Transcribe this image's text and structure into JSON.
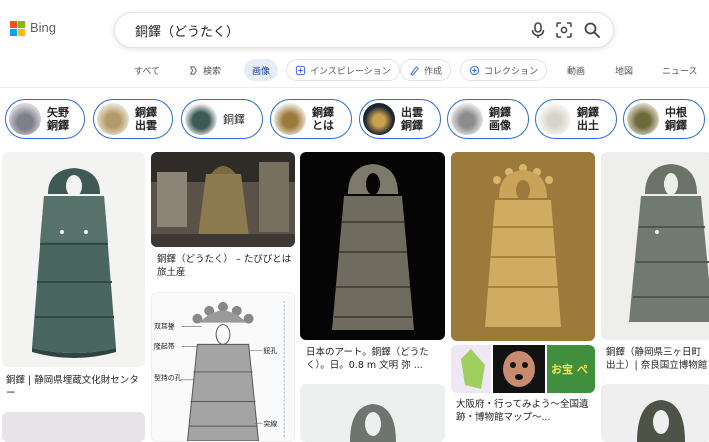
{
  "brand": {
    "name": "Bing",
    "logo_colors": [
      "#f25022",
      "#7fba00",
      "#00a4ef",
      "#ffb900"
    ]
  },
  "search": {
    "query": "銅鐸（どうたく）",
    "icons": [
      "microphone-icon",
      "visual-search-icon",
      "search-icon"
    ]
  },
  "tabs": [
    {
      "label": "すべて",
      "icon": null
    },
    {
      "label": "検索",
      "icon": "copilot-icon"
    },
    {
      "label": "画像",
      "icon": null,
      "active": true
    },
    {
      "label": "インスピレーション",
      "icon": "sparkle-icon"
    },
    {
      "label": "作成",
      "icon": "create-icon"
    },
    {
      "label": "コレクション",
      "icon": "collection-icon"
    },
    {
      "label": "動画",
      "icon": null
    },
    {
      "label": "地図",
      "icon": null
    },
    {
      "label": "ニュース",
      "icon": null
    }
  ],
  "related": [
    {
      "label": "矢野\n銅鐸"
    },
    {
      "label": "銅鐸\n出雲"
    },
    {
      "label": "銅鐸"
    },
    {
      "label": "銅鐸\nとは"
    },
    {
      "label": "出雲\n銅鐸"
    },
    {
      "label": "銅鐸\n画像"
    },
    {
      "label": "銅鐸\n出土"
    },
    {
      "label": "中根\n銅鐸"
    }
  ],
  "results": [
    {
      "caption": "銅鐸 | 静岡県埋蔵文化財センター"
    },
    {
      "caption": "銅鐸（どうたく） – たびびとは旅土産"
    },
    {
      "caption": "日本のアート。銅鐸（どうたく）。日。0.8 m 文明 弥 ..."
    },
    {
      "caption": "大阪府・行ってみよう～全国遺跡・博物館マップ～..."
    },
    {
      "caption": "銅鐸（静岡県三ヶ日町出土）| 奈良国立博物館"
    }
  ],
  "diagram_labels": [
    "双耳鋬",
    "隆起帯",
    "型持の孔",
    "鈕孔",
    "突線"
  ],
  "banner_text": "お宝 ぺ"
}
